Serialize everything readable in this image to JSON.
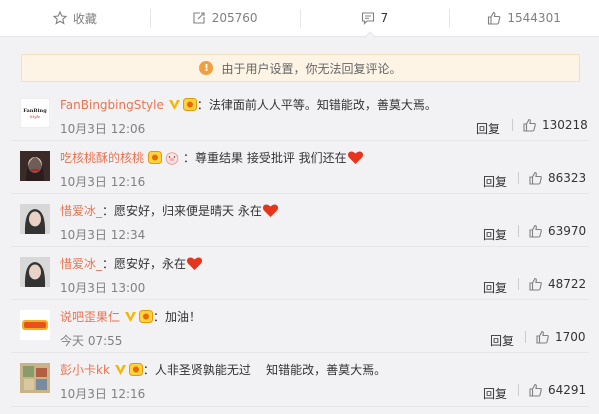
{
  "action_bar": {
    "favorite_label": "收藏",
    "repost_count": "205760",
    "comment_count": "7",
    "like_count": "1544301"
  },
  "notice": {
    "text": "由于用户设置，你无法回复评论。"
  },
  "comments": [
    {
      "user": "FanBingbingStyle",
      "text": "：法律面前人人平等。知错能改，善莫大焉。",
      "time": "10月3日 12:06",
      "reply": "回复",
      "likes": "130218"
    },
    {
      "user": "吃核桃酥的核桃",
      "text": "：尊重结果 接受批评  我们还在",
      "time": "10月3日 12:16",
      "reply": "回复",
      "likes": "86323"
    },
    {
      "user": "惜爱冰_",
      "text": "：愿安好，归来便是晴天 永在",
      "time": "10月3日 12:34",
      "reply": "回复",
      "likes": "63970"
    },
    {
      "user": "惜爱冰_",
      "text": "：愿安好，永在",
      "time": "10月3日 13:00",
      "reply": "回复",
      "likes": "48722"
    },
    {
      "user": "说吧歪果仁",
      "text": "：加油！",
      "time": "今天 07:55",
      "reply": "回复",
      "likes": "1700"
    },
    {
      "user": "彭小卡kk",
      "text": "：人非圣贤孰能无过    知错能改，善莫大焉。",
      "time": "10月3日 12:16",
      "reply": "回复",
      "likes": "64291"
    }
  ],
  "colors": {
    "username": "#eb7350",
    "heart": "#e8341c",
    "notice_icon": "#f0a040"
  }
}
